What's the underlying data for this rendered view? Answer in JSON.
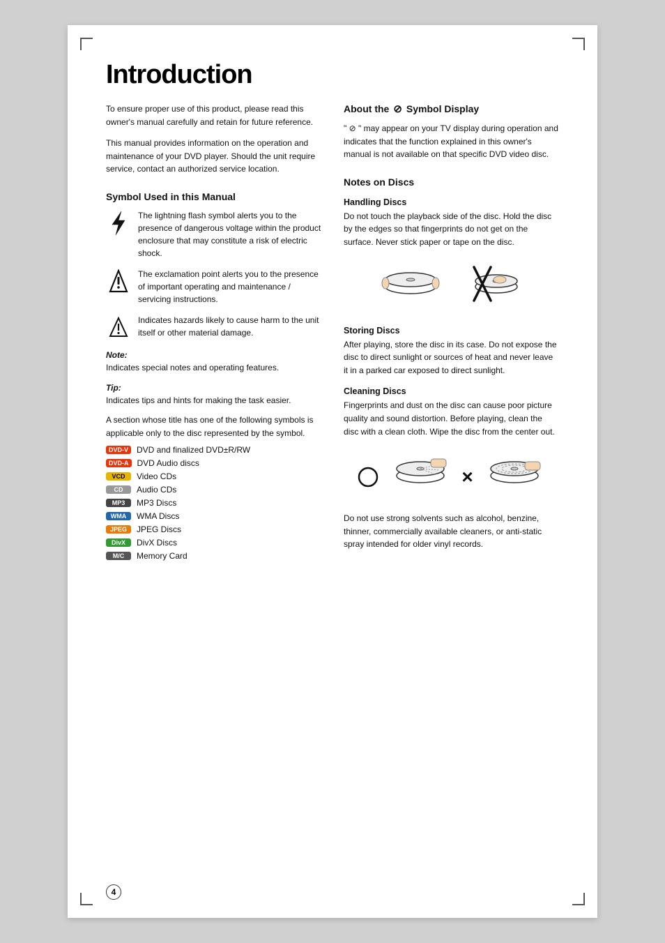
{
  "page": {
    "title": "Introduction",
    "page_number": "4",
    "intro_paragraphs": [
      "To ensure proper use of this product, please read this owner's manual carefully and retain for future reference.",
      "This manual provides information on the operation and maintenance of your DVD player. Should the unit require service, contact an authorized service location."
    ],
    "symbol_section": {
      "title": "Symbol Used in this Manual",
      "symbols": [
        {
          "icon": "lightning",
          "text": "The lightning flash symbol alerts you to the presence of dangerous voltage within the product enclosure that may constitute a risk of electric shock."
        },
        {
          "icon": "exclamation",
          "text": "The exclamation point alerts you to the presence of important operating and maintenance / servicing instructions."
        },
        {
          "icon": "triangle",
          "text": "Indicates hazards likely to cause harm to the unit itself or other material damage."
        }
      ],
      "note_label": "Note:",
      "note_text": "Indicates special notes and operating features.",
      "tip_label": "Tip:",
      "tip_text": "Indicates tips and hints for making the task easier.",
      "section_text": "A section whose title has one of the following symbols is applicable only to the disc represented by the symbol.",
      "disc_types": [
        {
          "badge_class": "badge-dvdv",
          "badge_text": "DVD-V",
          "label": "DVD and finalized DVD±R/RW"
        },
        {
          "badge_class": "badge-dvda",
          "badge_text": "DVD-A",
          "label": "DVD Audio discs"
        },
        {
          "badge_class": "badge-vcd",
          "badge_text": "VCD",
          "label": "Video CDs"
        },
        {
          "badge_class": "badge-cd",
          "badge_text": "CD",
          "label": "Audio CDs"
        },
        {
          "badge_class": "badge-mp3",
          "badge_text": "MP3",
          "label": "MP3 Discs"
        },
        {
          "badge_class": "badge-wma",
          "badge_text": "WMA",
          "label": "WMA Discs"
        },
        {
          "badge_class": "badge-jpeg",
          "badge_text": "JPEG",
          "label": "JPEG Discs"
        },
        {
          "badge_class": "badge-divx",
          "badge_text": "DivX",
          "label": "DivX Discs"
        },
        {
          "badge_class": "badge-mc",
          "badge_text": "M/C",
          "label": "Memory Card"
        }
      ]
    },
    "right_col": {
      "about_symbol": {
        "title_before": "About the",
        "symbol": "⊘",
        "title_after": "Symbol Display",
        "body": "\" ⊘ \" may appear on your TV display during operation and indicates that the function explained in this owner's manual is not available on that specific DVD video disc."
      },
      "notes_on_discs": {
        "title": "Notes on Discs",
        "handling": {
          "subtitle": "Handling Discs",
          "body": "Do not touch the playback side of the disc. Hold the disc by the edges so that fingerprints do not get on the surface. Never stick paper or tape on the disc."
        },
        "storing": {
          "subtitle": "Storing Discs",
          "body": "After playing, store the disc in its case. Do not expose the disc to direct sunlight or sources of heat and never leave it in a parked car exposed to direct sunlight."
        },
        "cleaning": {
          "subtitle": "Cleaning Discs",
          "body": "Fingerprints and dust on the disc can cause poor picture quality and sound distortion. Before playing, clean the disc with a clean cloth. Wipe the disc from the center out."
        },
        "no_solvents": "Do not use strong solvents such as alcohol, benzine, thinner, commercially available cleaners, or anti-static spray intended for older vinyl records."
      }
    }
  }
}
